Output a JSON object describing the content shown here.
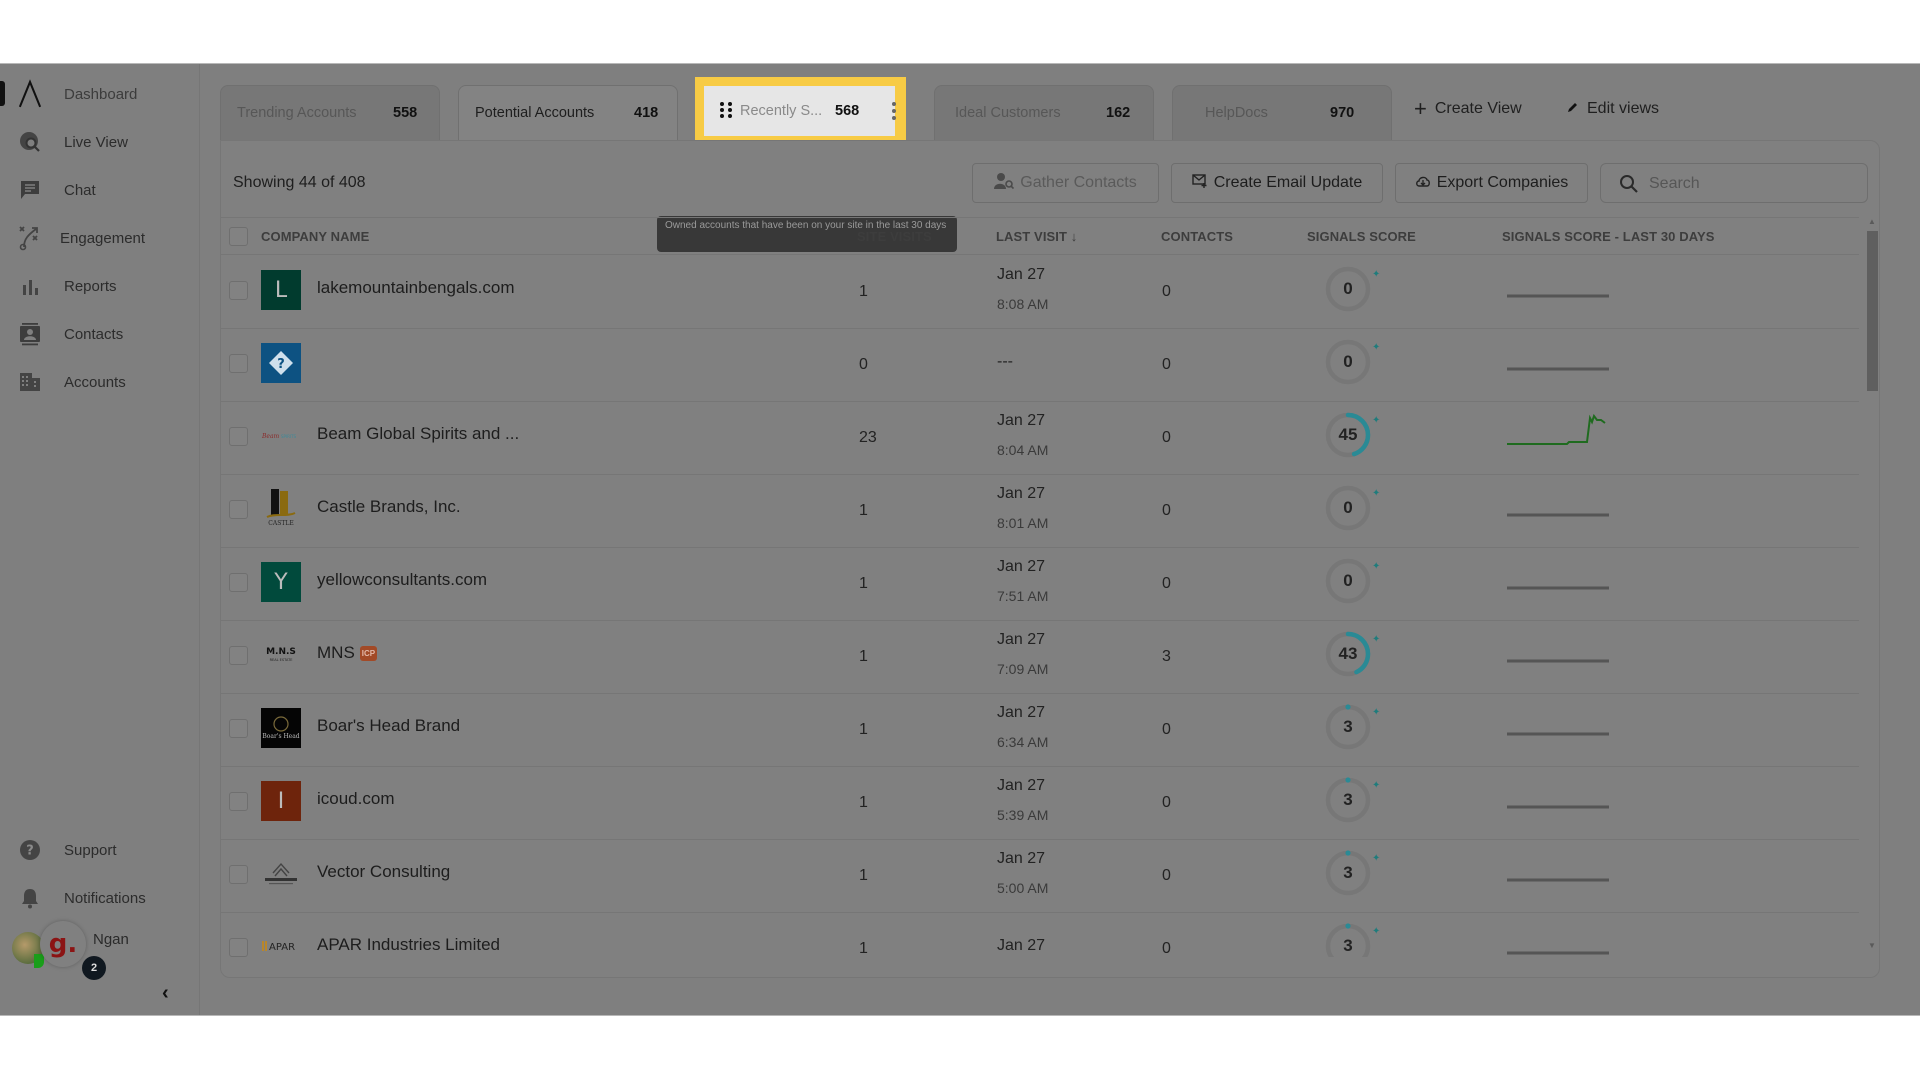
{
  "sidebar": {
    "items": [
      {
        "label": "Dashboard",
        "icon": "logo-icon"
      },
      {
        "label": "Live View",
        "icon": "live-view-icon"
      },
      {
        "label": "Chat",
        "icon": "chat-icon"
      },
      {
        "label": "Engagement",
        "icon": "engagement-icon"
      },
      {
        "label": "Reports",
        "icon": "bar-chart-icon"
      },
      {
        "label": "Contacts",
        "icon": "contacts-icon"
      },
      {
        "label": "Accounts",
        "icon": "building-icon"
      }
    ],
    "bottom": [
      {
        "label": "Support",
        "icon": "help-icon"
      },
      {
        "label": "Notifications",
        "icon": "bell-icon"
      }
    ],
    "user": {
      "name": "Ngan",
      "bubble_letter": "g.",
      "badge_count": "2"
    },
    "collapse_glyph": "‹"
  },
  "tabs": [
    {
      "label": "Trending Accounts",
      "count": "558",
      "state": "inactive"
    },
    {
      "label": "Potential Accounts",
      "count": "418",
      "state": "active"
    },
    {
      "label": "Recently S...",
      "count": "568",
      "state": "highlighted"
    },
    {
      "label": "Ideal Customers",
      "count": "162",
      "state": "inactive"
    },
    {
      "label": "HelpDocs",
      "count": "970",
      "state": "inactive"
    }
  ],
  "view_actions": {
    "create_view": "Create View",
    "edit_views": "Edit views"
  },
  "tooltip": "Owned accounts that have been on your site in the last 30 days",
  "toolbar": {
    "showing": "Showing 44 of  408",
    "gather_contacts": "Gather Contacts",
    "create_email_update": "Create Email Update",
    "export_companies": "Export Companies",
    "search_placeholder": "Search"
  },
  "table": {
    "columns": [
      "COMPANY NAME",
      "SITE VISITS",
      "LAST VISIT ↓",
      "CONTACTS",
      "SIGNALS SCORE",
      "SIGNALS SCORE - LAST 30 DAYS"
    ],
    "rows": [
      {
        "name": "lakemountainbengals.com",
        "logo": "L",
        "logo_color": "#013b2e",
        "site_visits": "1",
        "date": "Jan 27",
        "time": "8:08 AM",
        "contacts": "0",
        "score": "0",
        "trend": "flat"
      },
      {
        "name": "",
        "logo": "?",
        "logo_color": "#0d5282",
        "site_visits": "0",
        "date": "---",
        "time": "",
        "contacts": "0",
        "score": "0",
        "trend": "flat"
      },
      {
        "name": "Beam Global Spirits and ...",
        "logo": "beam",
        "logo_color": "",
        "site_visits": "23",
        "date": "Jan 27",
        "time": "8:04 AM",
        "contacts": "0",
        "score": "45",
        "trend": "spike"
      },
      {
        "name": "Castle Brands, Inc.",
        "logo": "castle",
        "logo_color": "",
        "site_visits": "1",
        "date": "Jan 27",
        "time": "8:01 AM",
        "contacts": "0",
        "score": "0",
        "trend": "flat"
      },
      {
        "name": "yellowconsultants.com",
        "logo": "Y",
        "logo_color": "#014a3c",
        "site_visits": "1",
        "date": "Jan 27",
        "time": "7:51 AM",
        "contacts": "0",
        "score": "0",
        "trend": "flat"
      },
      {
        "name": "MNS",
        "badge": "ICP",
        "logo": "M.N.S",
        "logo_color": "",
        "site_visits": "1",
        "date": "Jan 27",
        "time": "7:09 AM",
        "contacts": "3",
        "score": "43",
        "trend": "flat"
      },
      {
        "name": "Boar's Head Brand",
        "logo": "boars",
        "logo_color": "#050505",
        "site_visits": "1",
        "date": "Jan 27",
        "time": "6:34 AM",
        "contacts": "0",
        "score": "3",
        "trend": "flat"
      },
      {
        "name": "icoud.com",
        "logo": "I",
        "logo_color": "#6e240c",
        "site_visits": "1",
        "date": "Jan 27",
        "time": "5:39 AM",
        "contacts": "0",
        "score": "3",
        "trend": "flat"
      },
      {
        "name": "Vector Consulting",
        "logo": "vector",
        "logo_color": "",
        "site_visits": "1",
        "date": "Jan 27",
        "time": "5:00 AM",
        "contacts": "0",
        "score": "3",
        "trend": "flat"
      },
      {
        "name": "APAR Industries Limited",
        "logo": "APAR",
        "logo_color": "",
        "site_visits": "1",
        "date": "Jan 27",
        "time": "",
        "contacts": "0",
        "score": "3",
        "trend": "flat"
      }
    ]
  },
  "colors": {
    "highlight": "#f7cb45",
    "score_ring": "#2a8a95",
    "sparkline_up": "#1f6b1f",
    "icp_badge": "#a24a27"
  }
}
